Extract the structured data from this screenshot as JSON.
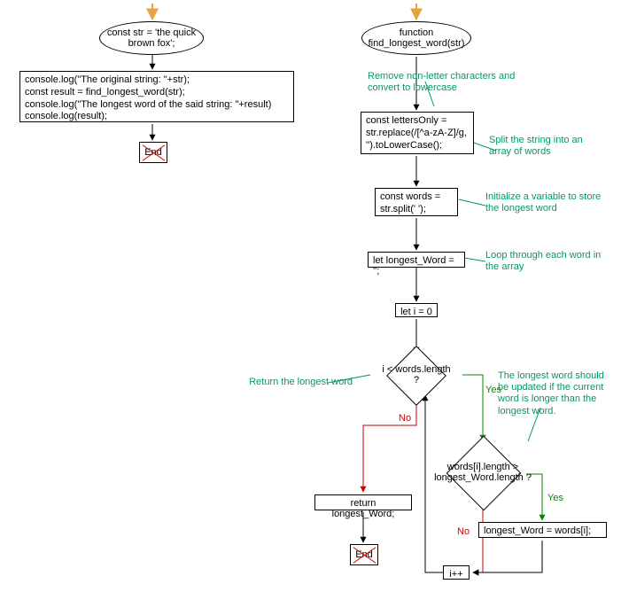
{
  "left": {
    "start": "const str = 'the quick brown fox';",
    "block": "console.log(\"The original string: \"+str);\nconst result = find_longest_word(str);\nconsole.log(\"The longest word of the said string: \"+result)\nconsole.log(result);",
    "end": "End"
  },
  "right": {
    "fn": "function find_longest_word(str)",
    "c1": "Remove non-letter characters and convert to lowercase",
    "n1": "const lettersOnly = str.replace(/[^a-zA-Z]/g, '').toLowerCase();",
    "c2": "Split the string into an array of words",
    "n2": "const words = str.split(' ');",
    "c3": "Initialize a variable to store the longest word",
    "n3": "let longest_Word = '';",
    "c4": "Loop through each word in the array",
    "n4": "let i = 0",
    "d1": "i < words.length ?",
    "c5": "Return the longest word",
    "c6": "The longest word should be updated if the current word is longer than the longest word.",
    "d2": "words[i].length > longest_Word.length ?",
    "ret": "return longest_Word;",
    "assign": "longest_Word = words[i];",
    "inc": "i++",
    "end": "End",
    "yes": "Yes",
    "no": "No"
  }
}
